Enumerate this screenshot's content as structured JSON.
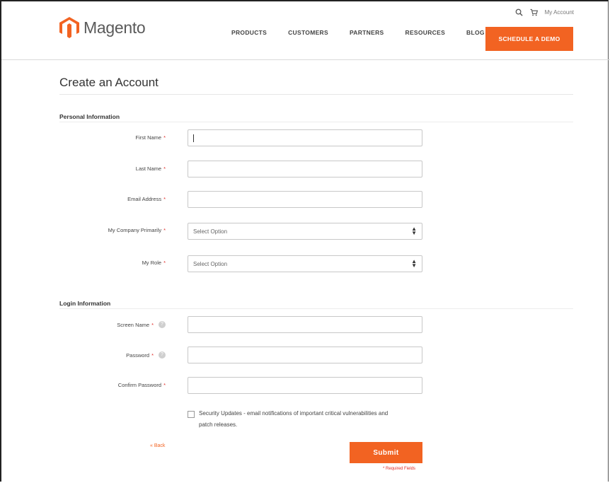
{
  "header": {
    "logo_text": "Magento",
    "my_account": "My Account",
    "nav": [
      "PRODUCTS",
      "CUSTOMERS",
      "PARTNERS",
      "RESOURCES",
      "BLOG"
    ],
    "demo_button": "SCHEDULE A DEMO"
  },
  "page": {
    "title": "Create an Account"
  },
  "personal": {
    "heading": "Personal Information",
    "first_name": "First Name",
    "last_name": "Last Name",
    "email": "Email Address",
    "company": "My Company Primarily",
    "company_select": "Select Option",
    "role": "My Role",
    "role_select": "Select Option"
  },
  "login": {
    "heading": "Login Information",
    "screen_name": "Screen Name",
    "password": "Password",
    "confirm_password": "Confirm Password"
  },
  "form": {
    "required_mark": "*",
    "security_updates": "Security Updates - email notifications of important critical vulnerabilities and patch releases.",
    "back": "« Back",
    "submit": "Submit",
    "required_fields": "* Required Fields"
  },
  "colors": {
    "accent": "#f26322",
    "required": "#e02b27"
  }
}
